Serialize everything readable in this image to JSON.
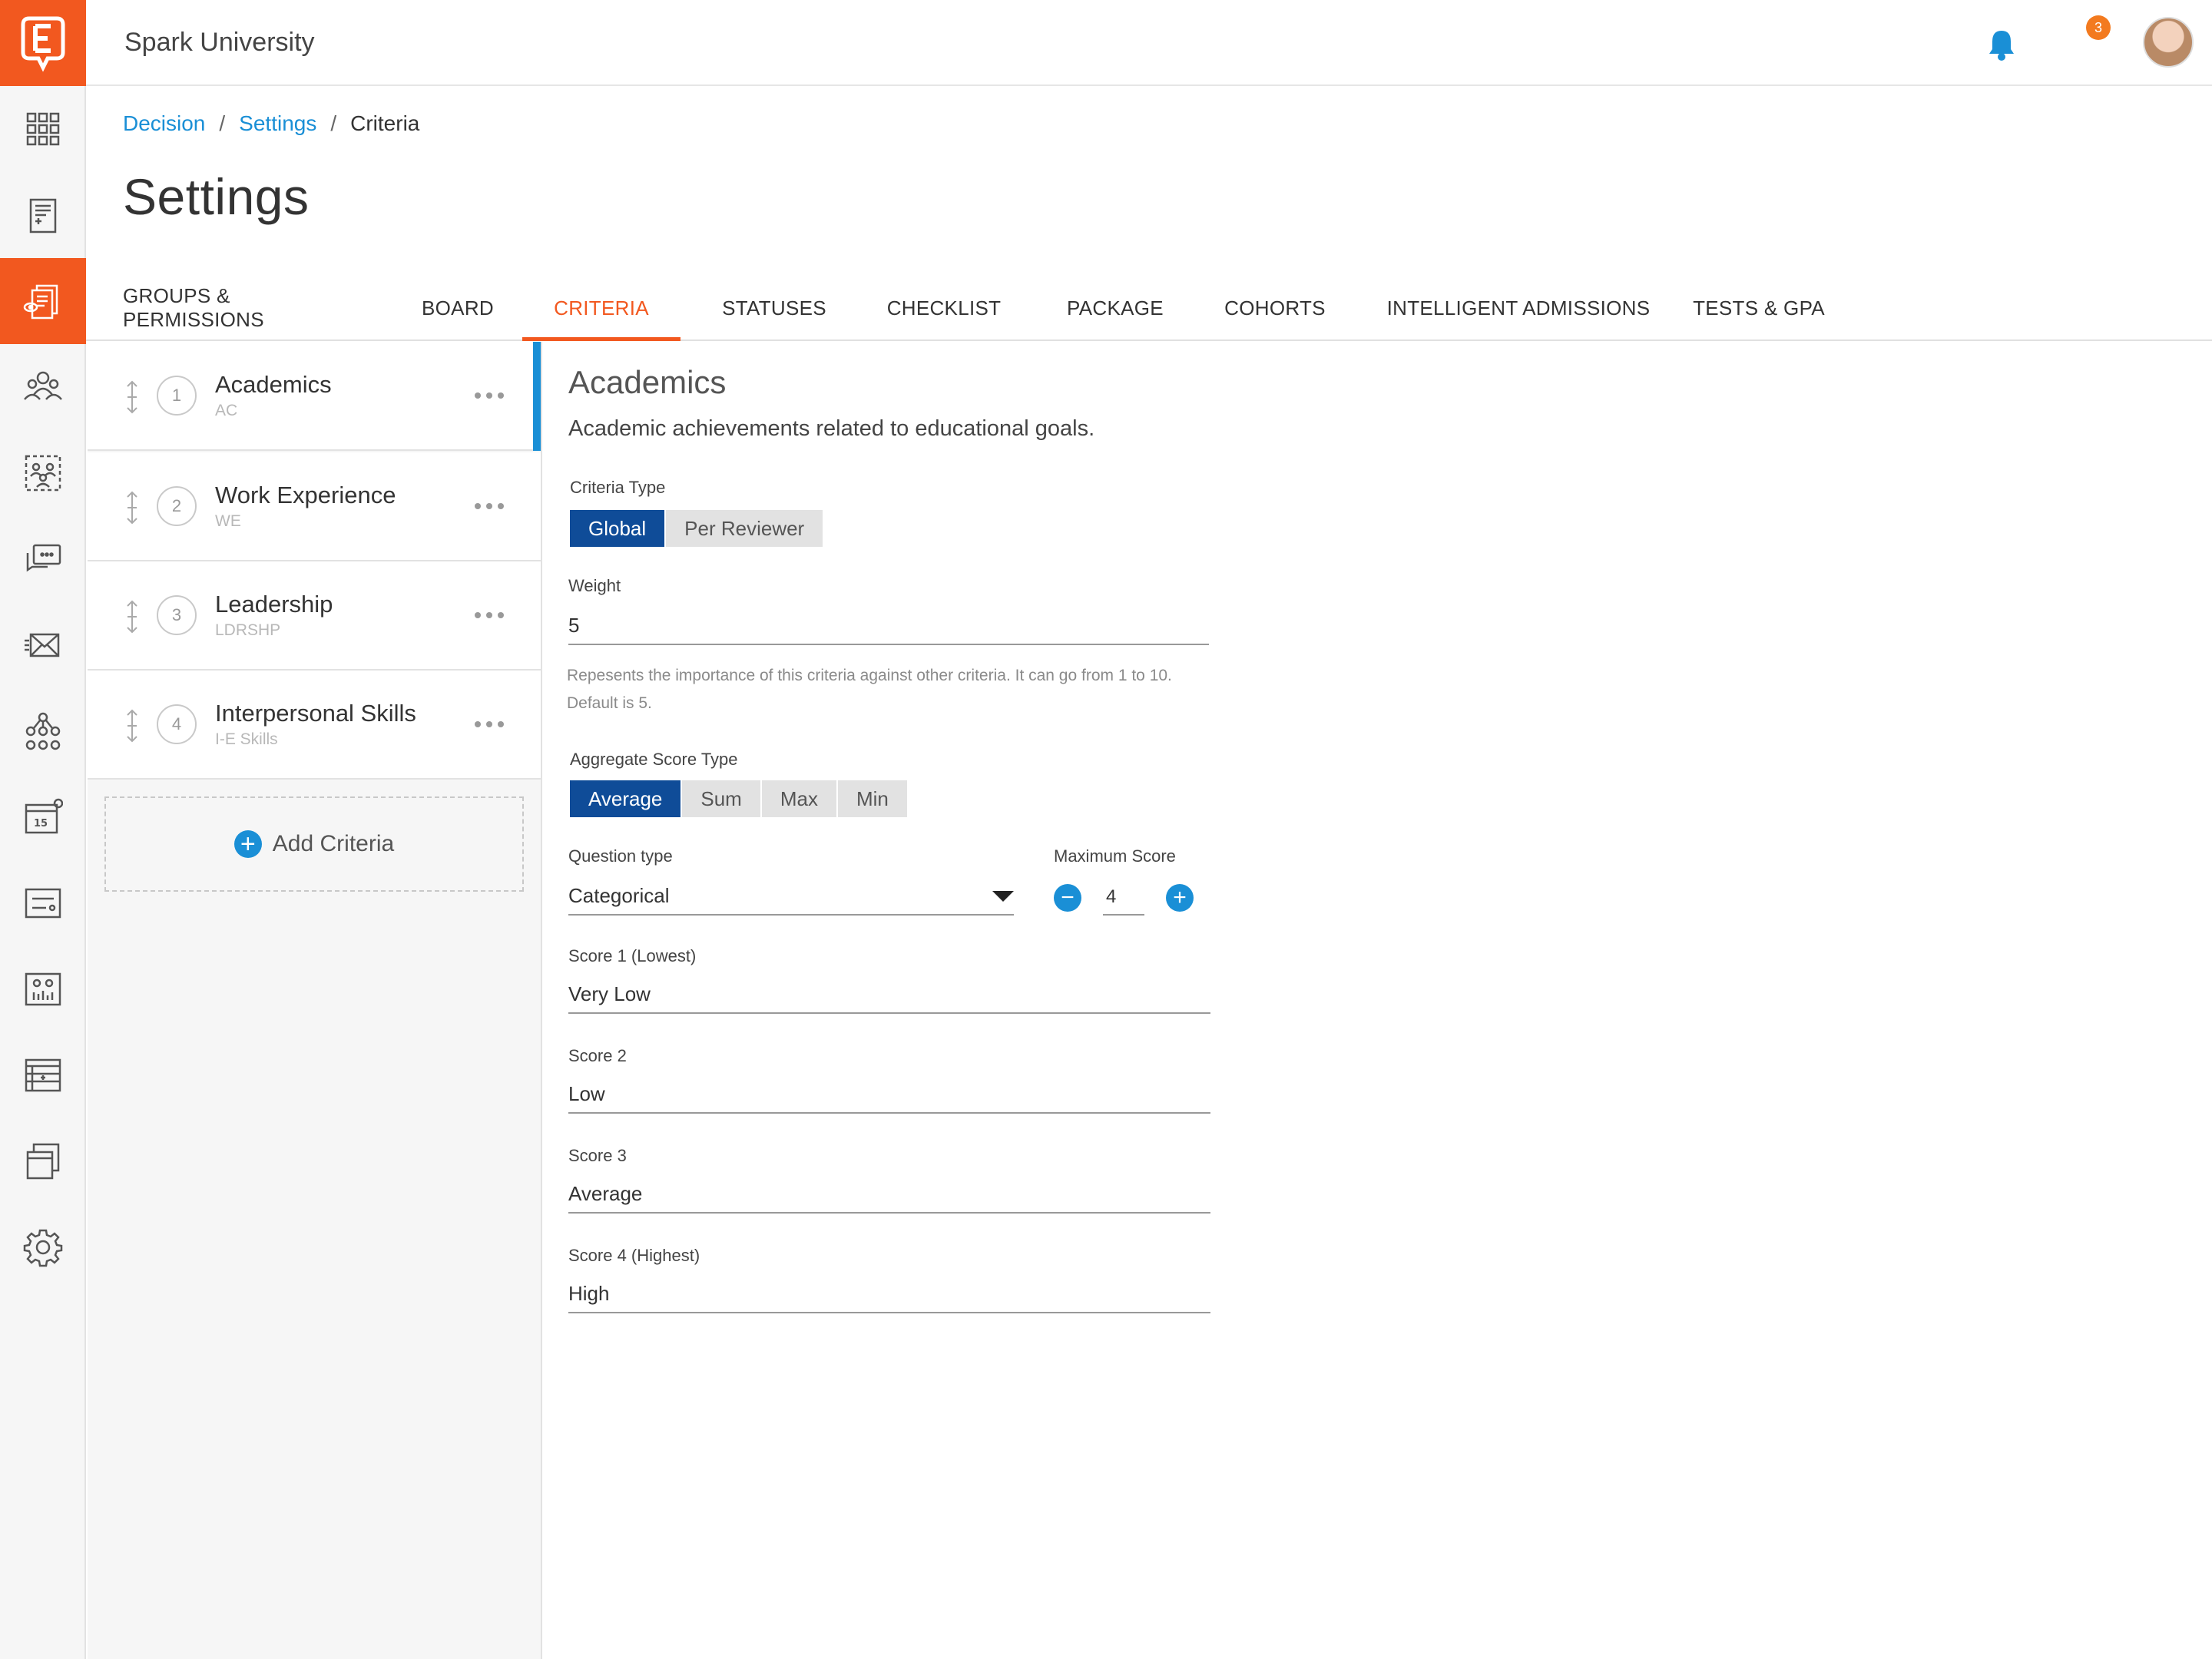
{
  "app": {
    "title": "Spark University",
    "notification_count": "3"
  },
  "breadcrumb": {
    "items": [
      "Decision",
      "Settings"
    ],
    "separator": "/",
    "current": "Criteria"
  },
  "page": {
    "title": "Settings"
  },
  "tabs": [
    {
      "label": "GROUPS & PERMISSIONS"
    },
    {
      "label": "BOARD"
    },
    {
      "label": "CRITERIA"
    },
    {
      "label": "STATUSES"
    },
    {
      "label": "CHECKLIST"
    },
    {
      "label": "PACKAGE"
    },
    {
      "label": "COHORTS"
    },
    {
      "label": "INTELLIGENT ADMISSIONS"
    },
    {
      "label": "TESTS & GPA"
    }
  ],
  "active_tab": "CRITERIA",
  "criteria": [
    {
      "number": "1",
      "name": "Academics",
      "code": "AC"
    },
    {
      "number": "2",
      "name": "Work Experience",
      "code": "WE"
    },
    {
      "number": "3",
      "name": "Leadership",
      "code": "LDRSHP"
    },
    {
      "number": "4",
      "name": "Interpersonal Skills",
      "code": "I-E Skills"
    }
  ],
  "add_criteria": {
    "label": "Add Criteria"
  },
  "detail": {
    "title": "Academics",
    "description": "Academic achievements related to educational goals.",
    "criteria_type": {
      "label": "Criteria Type",
      "options": [
        "Global",
        "Per Reviewer"
      ],
      "selected": "Global"
    },
    "weight": {
      "label": "Weight",
      "value": "5",
      "help": "Repesents the importance of this criteria against other criteria. It can go from 1 to 10. Default is 5."
    },
    "aggregate": {
      "label": "Aggregate Score Type",
      "options": [
        "Average",
        "Sum",
        "Max",
        "Min"
      ],
      "selected": "Average"
    },
    "question_type": {
      "label": "Question type",
      "value": "Categorical"
    },
    "max_score": {
      "label": "Maximum Score",
      "value": "4",
      "minus": "−",
      "plus": "+"
    },
    "scores": [
      {
        "label": "Score 1 (Lowest)",
        "value": "Very Low"
      },
      {
        "label": "Score 2",
        "value": "Low"
      },
      {
        "label": "Score 3",
        "value": "Average"
      },
      {
        "label": "Score 4 (Highest)",
        "value": "High"
      }
    ]
  },
  "colors": {
    "brand": "#f2581f",
    "link": "#1a8fd6",
    "segment_active": "#0f4c98",
    "badge": "#f37a1f"
  },
  "rail_icons": [
    "dashboard-icon",
    "application-icon",
    "decision-icon",
    "users-icon",
    "groups-icon",
    "chat-icon",
    "mail-icon",
    "hierarchy-icon",
    "calendar-icon",
    "form-icon",
    "reports-icon",
    "table-icon",
    "documents-icon",
    "gear-icon"
  ]
}
